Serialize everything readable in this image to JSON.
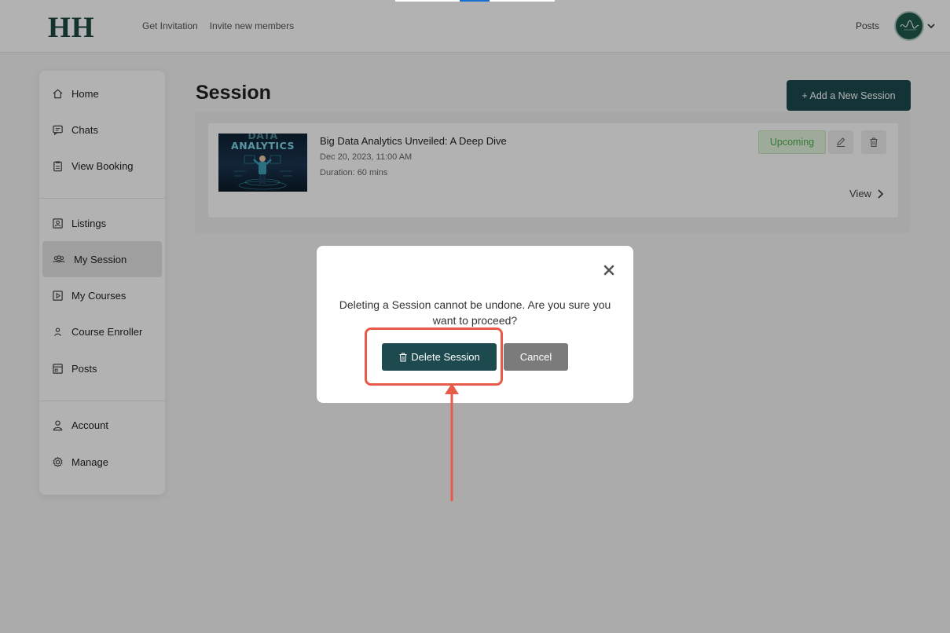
{
  "header": {
    "logo": "HH",
    "nav": [
      "Get Invitation",
      "Invite new members"
    ],
    "posts": "Posts",
    "avatar_icon": "avatar-signature"
  },
  "sidebar": {
    "items": [
      {
        "label": "Home",
        "icon": "home-icon"
      },
      {
        "label": "Chats",
        "icon": "chat-icon"
      },
      {
        "label": "View Booking",
        "icon": "clipboard-icon"
      },
      {
        "label": "Listings",
        "icon": "listing-icon"
      },
      {
        "label": "My Session",
        "icon": "group-icon",
        "active": true
      },
      {
        "label": "My Courses",
        "icon": "play-box-icon"
      },
      {
        "label": "Course Enroller",
        "icon": "user-icon"
      },
      {
        "label": "Posts",
        "icon": "posts-icon"
      },
      {
        "label": "Account",
        "icon": "account-icon"
      },
      {
        "label": "Manage",
        "icon": "gear-icon"
      }
    ]
  },
  "main": {
    "title": "Session",
    "add_button": "+ Add a New Session",
    "session": {
      "thumbnail_text": "DATA\nANALYTICS",
      "title": "Big Data Analytics Unveiled: A Deep Dive",
      "date": "Dec 20, 2023, 11:00 AM",
      "duration": "Duration: 60 mins",
      "status": "Upcoming",
      "view": "View"
    }
  },
  "modal": {
    "message": "Deleting a Session cannot be undone. Are you sure you want to proceed?",
    "delete_label": "Delete Session",
    "cancel_label": "Cancel"
  },
  "colors": {
    "primary": "#1d4a4f",
    "upcoming": "#4caf50",
    "annotation": "#e85b4a"
  }
}
